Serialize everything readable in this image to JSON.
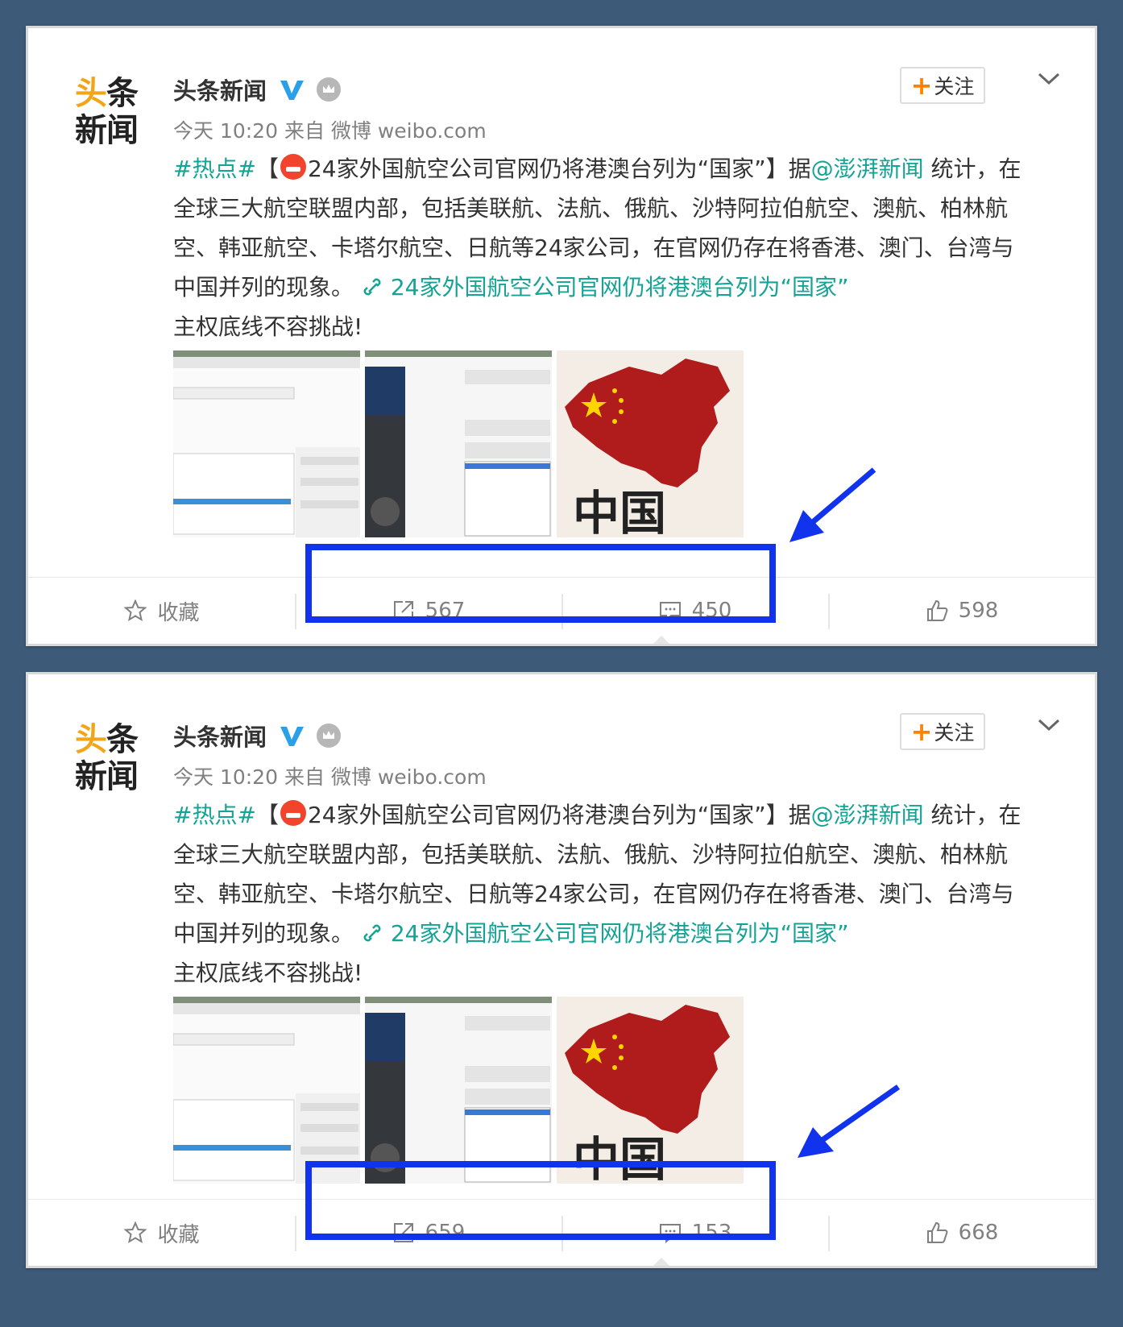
{
  "posts": [
    {
      "logo": {
        "line1a": "头",
        "line1b": "条",
        "line2": "新闻"
      },
      "username": "头条新闻",
      "follow_label": "关注",
      "meta": "今天 10:20 来自 微博 weibo.com",
      "text": {
        "tag": "#热点#",
        "bracket_open": "【",
        "headline": "24家外国航空公司官网仍将港澳台列为“国家”】据",
        "mention": "@澎湃新闻",
        "body": " 统计，在全球三大航空联盟内部，包括美联航、法航、俄航、沙特阿拉伯航空、澳航、柏林航空、韩亚航空、卡塔尔航空、日航等24家公司，在官网仍存在将香港、澳门、台湾与中国并列的现象。",
        "link": "24家外国航空公司官网仍将港澳台列为“国家”",
        "tail": "主权底线不容挑战!"
      },
      "map_text": "中国",
      "actions": {
        "favorite": "收藏",
        "repost": "567",
        "comment": "450",
        "like": "598"
      }
    },
    {
      "logo": {
        "line1a": "头",
        "line1b": "条",
        "line2": "新闻"
      },
      "username": "头条新闻",
      "follow_label": "关注",
      "meta": "今天 10:20 来自 微博 weibo.com",
      "text": {
        "tag": "#热点#",
        "bracket_open": "【",
        "headline": "24家外国航空公司官网仍将港澳台列为“国家”】据",
        "mention": "@澎湃新闻",
        "body": " 统计，在全球三大航空联盟内部，包括美联航、法航、俄航、沙特阿拉伯航空、澳航、柏林航空、韩亚航空、卡塔尔航空、日航等24家公司，在官网仍存在将香港、澳门、台湾与中国并列的现象。",
        "link": "24家外国航空公司官网仍将港澳台列为“国家”",
        "tail": "主权底线不容挑战!"
      },
      "map_text": "中国",
      "actions": {
        "favorite": "收藏",
        "repost": "659",
        "comment": "153",
        "like": "668"
      }
    }
  ],
  "colors": {
    "background": "#3d5a78",
    "highlight": "#1133ee",
    "link": "#14a394",
    "follow_plus": "#ff8200",
    "logo_accent": "#f2a516"
  }
}
